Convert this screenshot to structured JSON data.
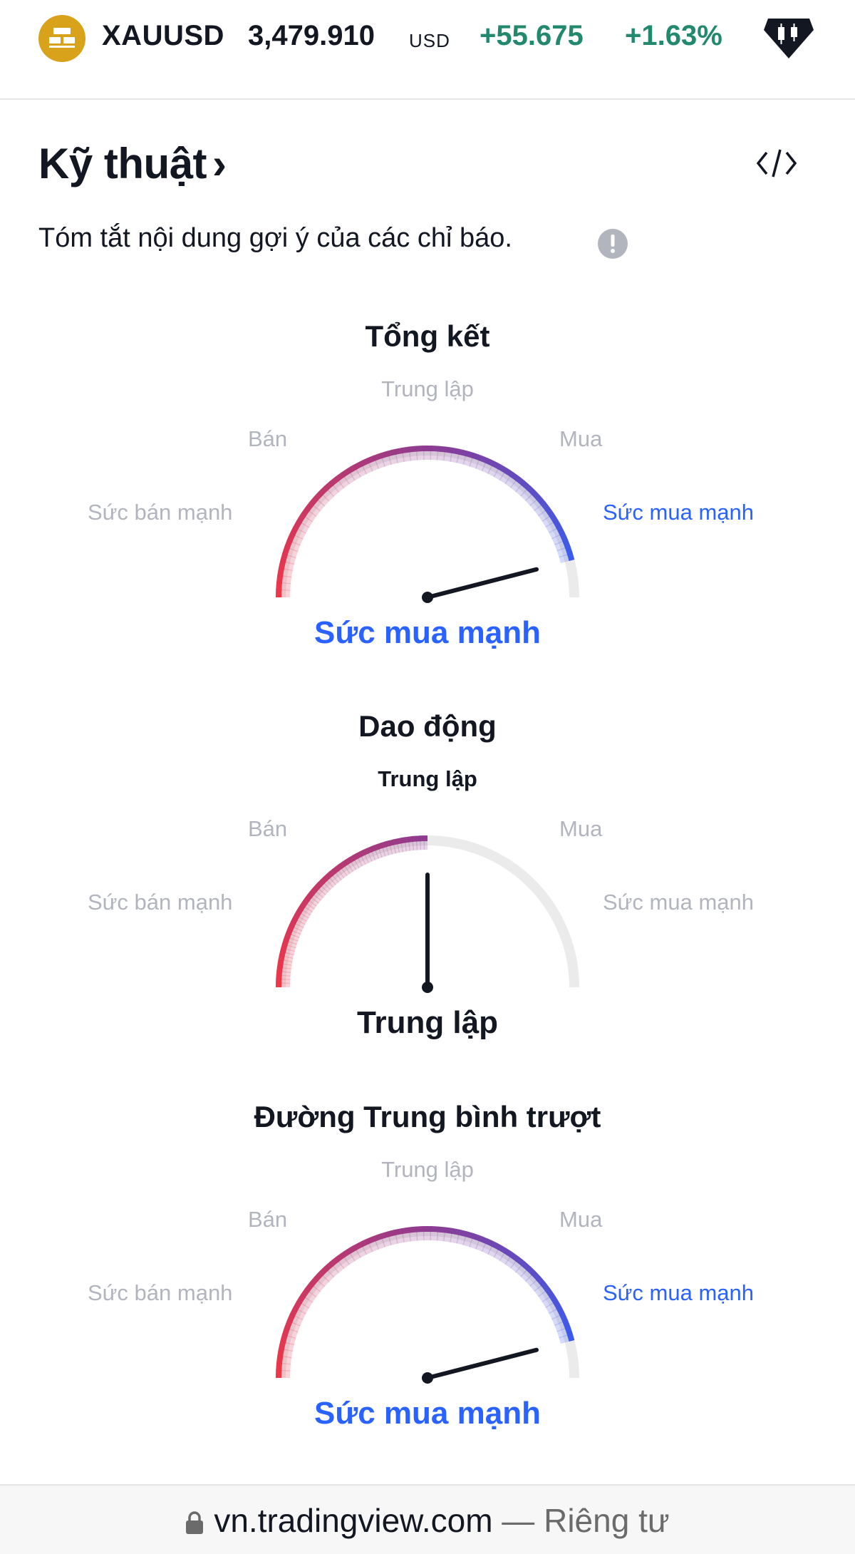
{
  "ticker": {
    "symbol": "XAUUSD",
    "price": "3,479.910",
    "currency": "USD",
    "change": "+55.675",
    "change_pct": "+1.63%",
    "change_color": "#22896f",
    "icon": "gold-bars-icon",
    "logo_icon": "candlestick-logo-icon"
  },
  "section": {
    "title": "Kỹ thuật",
    "chevron": "›",
    "embed_icon": "code-embed-icon",
    "subtitle": "Tóm tắt nội dung gợi ý của các chỉ báo.",
    "info_icon": "info-icon"
  },
  "scale_labels": {
    "strong_sell": "Sức bán mạnh",
    "sell": "Bán",
    "neutral": "Trung lập",
    "buy": "Mua",
    "strong_buy": "Sức mua mạnh"
  },
  "gauges": [
    {
      "title": "Tổng kết",
      "result": "Sức mua mạnh",
      "level": 0.92
    },
    {
      "title": "Dao động",
      "result": "Trung lập",
      "level": 0.5
    },
    {
      "title": "Đường Trung bình trượt",
      "result": "Sức mua mạnh",
      "level": 0.92
    }
  ],
  "colors": {
    "sell": "#f23645",
    "neutral": "#8e3b91",
    "buy": "#2962ff",
    "track": "#ebebeb"
  },
  "browser": {
    "domain": "vn.tradingview.com",
    "separator": " — ",
    "mode": "Riêng tư",
    "lock_icon": "lock-icon"
  }
}
